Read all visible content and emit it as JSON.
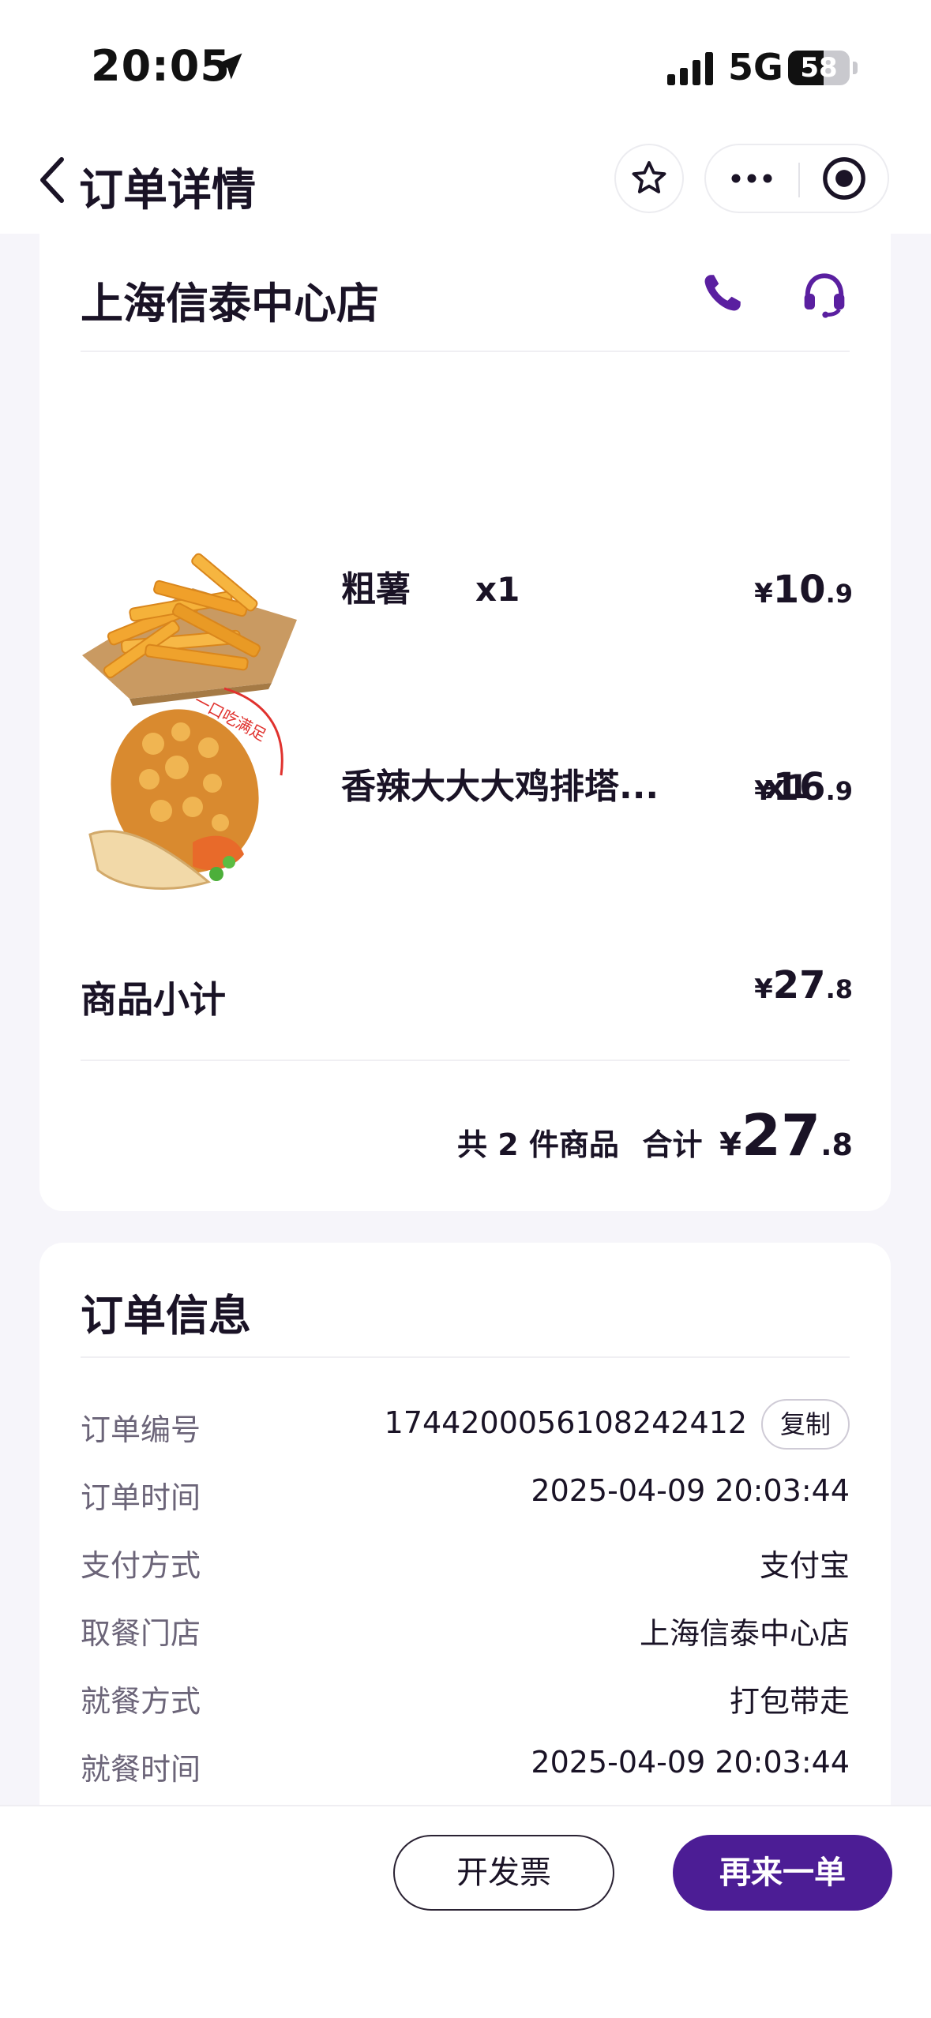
{
  "status_bar": {
    "time": "20:05",
    "network": "5G",
    "battery_level": "58",
    "battery_fraction": 0.58,
    "location_icon": "location-arrow-icon",
    "signal_icon": "cellular-signal-icon"
  },
  "nav": {
    "title": "订单详情",
    "back_icon": "chevron-left-icon",
    "favorite_icon": "star-icon",
    "more_icon": "more-dots-icon",
    "close_icon": "target-close-icon"
  },
  "store": {
    "name": "上海信泰中心店",
    "phone_icon": "phone-icon",
    "service_icon": "headset-icon"
  },
  "items": [
    {
      "name": "粗薯",
      "qty": "x1",
      "currency": "¥",
      "price_int": "10",
      "price_dec": ".9",
      "image": "fries-image"
    },
    {
      "name": "香辣大大大鸡排塔...",
      "qty": "x1",
      "currency": "¥",
      "price_int": "16",
      "price_dec": ".9",
      "image": "chicken-taco-image",
      "image_tag": "一口吃满足"
    }
  ],
  "subtotal": {
    "label": "商品小计",
    "currency": "¥",
    "int": "27",
    "dec": ".8"
  },
  "total": {
    "count_text": "共 2 件商品",
    "label": "合计",
    "currency": "¥",
    "int": "27",
    "dec": ".8"
  },
  "order_info": {
    "title": "订单信息",
    "copy_label": "复制",
    "rows": [
      {
        "label": "订单编号",
        "value": "1744200056108242412"
      },
      {
        "label": "订单时间",
        "value": "2025-04-09 20:03:44"
      },
      {
        "label": "支付方式",
        "value": "支付宝"
      },
      {
        "label": "取餐门店",
        "value": "上海信泰中心店"
      },
      {
        "label": "就餐方式",
        "value": "打包带走"
      },
      {
        "label": "就餐时间",
        "value": "2025-04-09 20:03:44"
      }
    ]
  },
  "actions": {
    "invoice": "开发票",
    "reorder": "再来一单"
  },
  "colors": {
    "brand": "#4c1d95",
    "text": "#1a1326",
    "muted": "#6b6478",
    "page_bg": "#f6f5fa"
  }
}
